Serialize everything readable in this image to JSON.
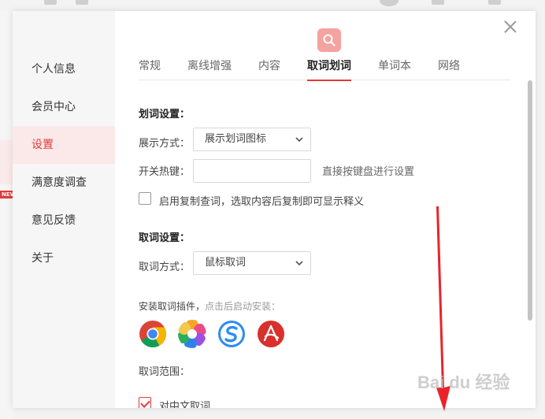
{
  "sidebar": {
    "items": [
      {
        "label": "个人信息"
      },
      {
        "label": "会员中心"
      },
      {
        "label": "设置",
        "active": true
      },
      {
        "label": "满意度调查"
      },
      {
        "label": "意见反馈"
      },
      {
        "label": "关于"
      }
    ],
    "badge": "NEW"
  },
  "tabs": [
    {
      "label": "常规"
    },
    {
      "label": "离线增强"
    },
    {
      "label": "内容"
    },
    {
      "label": "取词划词",
      "active": true
    },
    {
      "label": "单词本"
    },
    {
      "label": "网络"
    }
  ],
  "huaci": {
    "title": "划词设置：",
    "display_label": "展示方式：",
    "display_value": "展示划词图标",
    "hotkey_label": "开关热键：",
    "hotkey_value": "",
    "hotkey_hint": "直接按键盘进行设置",
    "copy_checkbox_label": "启用复制查词，选取内容后复制即可显示释义",
    "copy_checked": false
  },
  "quci": {
    "title": "取词设置：",
    "mode_label": "取词方式：",
    "mode_value": "鼠标取词"
  },
  "plugins": {
    "text": "安装取词插件，",
    "subtext": "点击后启动安装：",
    "items": [
      {
        "icon": "chrome-icon"
      },
      {
        "icon": "colorful-browser-icon"
      },
      {
        "icon": "sogou-browser-icon"
      },
      {
        "icon": "adobe-acrobat-icon"
      }
    ]
  },
  "scope": {
    "title": "取词范围：",
    "item_label": "对中文取词",
    "item_checked": true
  },
  "watermark": "Bai du 经验",
  "colors": {
    "accent": "#e23a3a",
    "logo": "#f4a3a0"
  }
}
